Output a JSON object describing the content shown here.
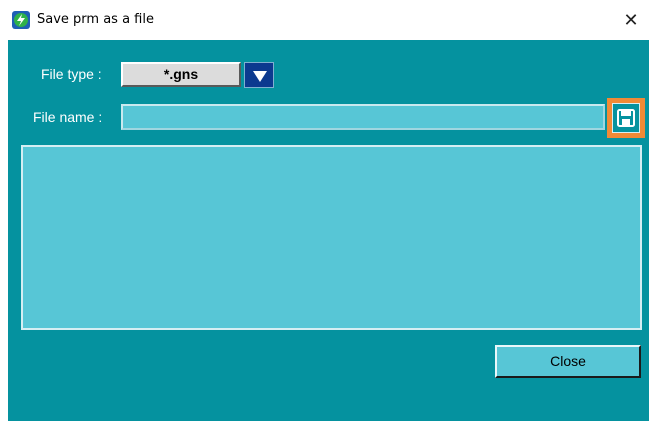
{
  "window": {
    "title": "Save prm as a file",
    "close_glyph": "✕",
    "app_icon": "app-bolt-icon"
  },
  "form": {
    "file_type_label": "File type :",
    "file_type_value": "*.gns",
    "file_name_label": "File name :",
    "file_name_value": ""
  },
  "buttons": {
    "close_label": "Close",
    "save_icon": "floppy-disk-icon"
  },
  "colors": {
    "client_bg": "#05929f",
    "field_bg": "#57c6d6",
    "dropdown_bg": "#0c3a8f",
    "save_highlight": "#f08a36"
  }
}
